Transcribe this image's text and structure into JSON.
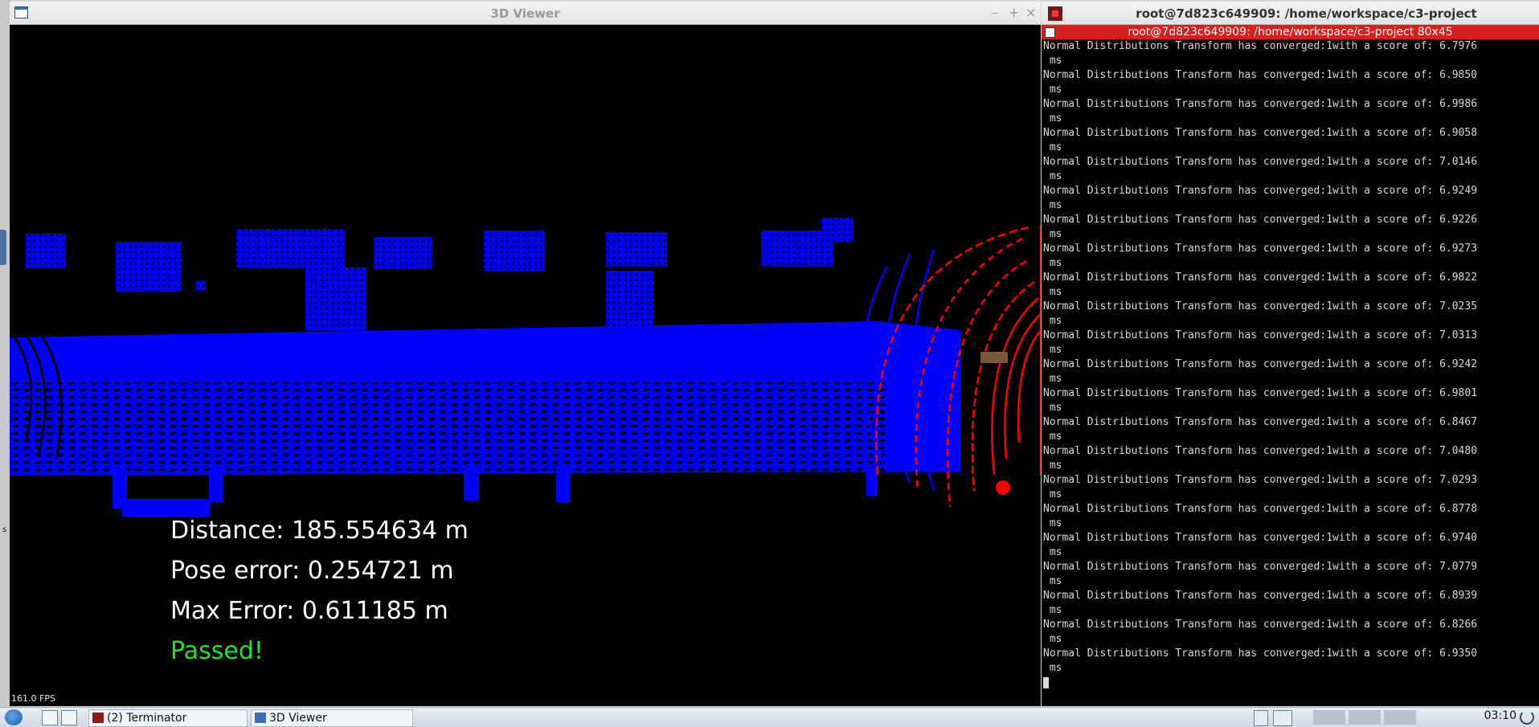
{
  "viewer": {
    "title": "3D Viewer",
    "controls": {
      "minimize": "–",
      "maximize": "+",
      "close": "×"
    },
    "hud": {
      "distance": "Distance: 185.554634 m",
      "pose_error": "Pose error: 0.254721 m",
      "max_error": "Max Error: 0.611185 m",
      "status": "Passed!"
    },
    "fps": "161.0 FPS",
    "colors": {
      "map_cloud": "#0000ff",
      "scan_cloud": "#ff0000",
      "passed": "#26e02a"
    }
  },
  "terminal": {
    "title": "root@7d823c649909: /home/workspace/c3-project",
    "subtitle": "root@7d823c649909: /home/workspace/c3-project 80x45",
    "lines": [
      "Normal Distributions Transform has converged:1with a score of: 6.7976",
      " ms",
      "Normal Distributions Transform has converged:1with a score of: 6.9850",
      " ms",
      "Normal Distributions Transform has converged:1with a score of: 6.9986",
      " ms",
      "Normal Distributions Transform has converged:1with a score of: 6.9058",
      " ms",
      "Normal Distributions Transform has converged:1with a score of: 7.0146",
      " ms",
      "Normal Distributions Transform has converged:1with a score of: 6.9249",
      " ms",
      "Normal Distributions Transform has converged:1with a score of: 6.9226",
      " ms",
      "Normal Distributions Transform has converged:1with a score of: 6.9273",
      " ms",
      "Normal Distributions Transform has converged:1with a score of: 6.9822",
      " ms",
      "Normal Distributions Transform has converged:1with a score of: 7.0235",
      " ms",
      "Normal Distributions Transform has converged:1with a score of: 7.0313",
      " ms",
      "Normal Distributions Transform has converged:1with a score of: 6.9242",
      " ms",
      "Normal Distributions Transform has converged:1with a score of: 6.9801",
      " ms",
      "Normal Distributions Transform has converged:1with a score of: 6.8467",
      " ms",
      "Normal Distributions Transform has converged:1with a score of: 7.0480",
      " ms",
      "Normal Distributions Transform has converged:1with a score of: 7.0293",
      " ms",
      "Normal Distributions Transform has converged:1with a score of: 6.8778",
      " ms",
      "Normal Distributions Transform has converged:1with a score of: 6.9740",
      " ms",
      "Normal Distributions Transform has converged:1with a score of: 7.0779",
      " ms",
      "Normal Distributions Transform has converged:1with a score of: 6.8939",
      " ms",
      "Normal Distributions Transform has converged:1with a score of: 6.8266",
      " ms",
      "Normal Distributions Transform has converged:1with a score of: 6.9350",
      " ms"
    ]
  },
  "taskbar": {
    "items": [
      {
        "label": "(2) Terminator",
        "icon": "terminator-icon"
      },
      {
        "label": "3D Viewer",
        "icon": "window-icon"
      }
    ],
    "clock": "03:10"
  }
}
